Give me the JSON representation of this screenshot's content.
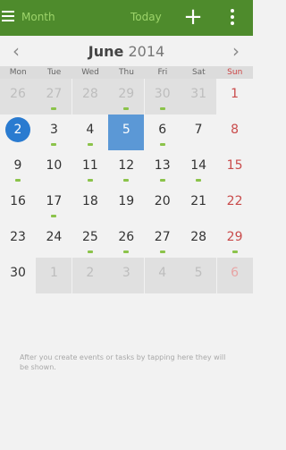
{
  "app_bar": {
    "view_label": "Month",
    "today_label": "Today",
    "add_icon": "plus-icon",
    "menu_icon": "hamburger-icon",
    "more_icon": "more-vert-icon",
    "color": "#4e8b2c"
  },
  "calendar": {
    "month": "June",
    "year": "2014",
    "weekdays": [
      "Mon",
      "Tue",
      "Wed",
      "Thu",
      "Fri",
      "Sat",
      "Sun"
    ],
    "weeks": [
      [
        {
          "day": "26",
          "out": true
        },
        {
          "day": "27",
          "out": true,
          "event": true
        },
        {
          "day": "28",
          "out": true
        },
        {
          "day": "29",
          "out": true,
          "event": true
        },
        {
          "day": "30",
          "out": true,
          "event": true
        },
        {
          "day": "31",
          "out": true
        },
        {
          "day": "1"
        }
      ],
      [
        {
          "day": "2",
          "today": true
        },
        {
          "day": "3",
          "event": true
        },
        {
          "day": "4",
          "event": true
        },
        {
          "day": "5",
          "selected": true
        },
        {
          "day": "6",
          "event": true
        },
        {
          "day": "7"
        },
        {
          "day": "8"
        }
      ],
      [
        {
          "day": "9",
          "event": true
        },
        {
          "day": "10"
        },
        {
          "day": "11",
          "event": true
        },
        {
          "day": "12",
          "event": true
        },
        {
          "day": "13",
          "event": true
        },
        {
          "day": "14",
          "event": true
        },
        {
          "day": "15"
        }
      ],
      [
        {
          "day": "16"
        },
        {
          "day": "17",
          "event": true
        },
        {
          "day": "18"
        },
        {
          "day": "19"
        },
        {
          "day": "20"
        },
        {
          "day": "21"
        },
        {
          "day": "22"
        }
      ],
      [
        {
          "day": "23"
        },
        {
          "day": "24"
        },
        {
          "day": "25",
          "event": true
        },
        {
          "day": "26",
          "event": true
        },
        {
          "day": "27",
          "event": true
        },
        {
          "day": "28"
        },
        {
          "day": "29",
          "event": true
        }
      ],
      [
        {
          "day": "30"
        },
        {
          "day": "1",
          "out": true
        },
        {
          "day": "2",
          "out": true
        },
        {
          "day": "3",
          "out": true
        },
        {
          "day": "4",
          "out": true
        },
        {
          "day": "5",
          "out": true
        },
        {
          "day": "6",
          "out": true
        }
      ]
    ]
  },
  "empty_message": "After you create events or tasks by tapping here they will be shown."
}
